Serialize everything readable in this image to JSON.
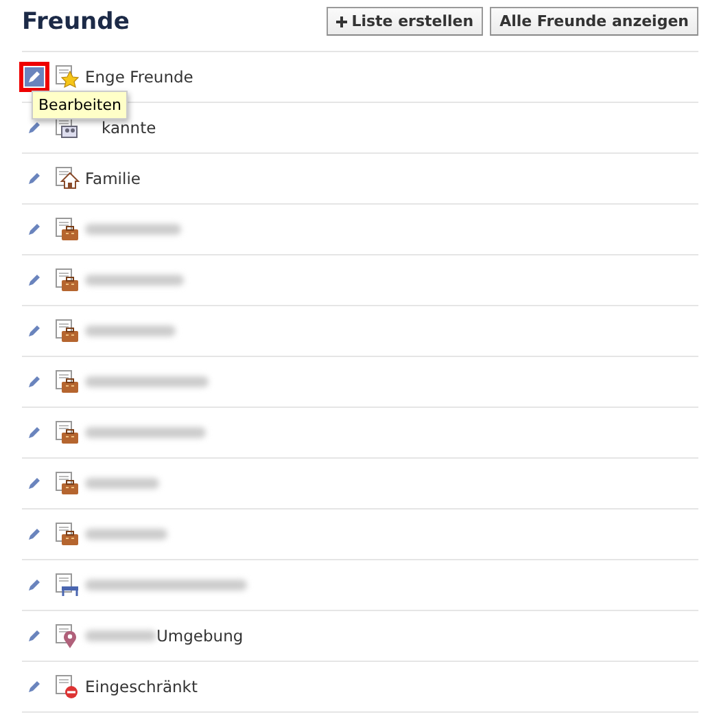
{
  "header": {
    "title": "Freunde",
    "buttons": [
      {
        "label": "Liste erstellen",
        "kind": "add"
      },
      {
        "label": "Alle Freunde anzeigen",
        "kind": "plain"
      }
    ]
  },
  "lists": [
    {
      "label": "Enge Freunde",
      "kind": "star",
      "edit_highlighted": true,
      "tooltip": "Bearbeiten"
    },
    {
      "label": "kannte",
      "kind": "people",
      "edit_highlighted": false,
      "partly_covered": true
    },
    {
      "label": "Familie",
      "kind": "house",
      "edit_highlighted": false
    },
    {
      "kind": "briefcase",
      "edit_highlighted": false,
      "blurred": true
    },
    {
      "kind": "briefcase",
      "edit_highlighted": false,
      "blurred": true
    },
    {
      "kind": "briefcase",
      "edit_highlighted": false,
      "blurred": true
    },
    {
      "kind": "briefcase",
      "edit_highlighted": false,
      "blurred": true
    },
    {
      "kind": "briefcase",
      "edit_highlighted": false,
      "blurred": true
    },
    {
      "kind": "briefcase",
      "edit_highlighted": false,
      "blurred": true
    },
    {
      "kind": "briefcase",
      "edit_highlighted": false,
      "blurred": true
    },
    {
      "kind": "school",
      "edit_highlighted": false,
      "blurred": true
    },
    {
      "label": "Umgebung",
      "kind": "pin",
      "edit_highlighted": false,
      "blurred": true
    },
    {
      "label": "Eingeschränkt",
      "kind": "restricted",
      "edit_highlighted": false
    }
  ]
}
